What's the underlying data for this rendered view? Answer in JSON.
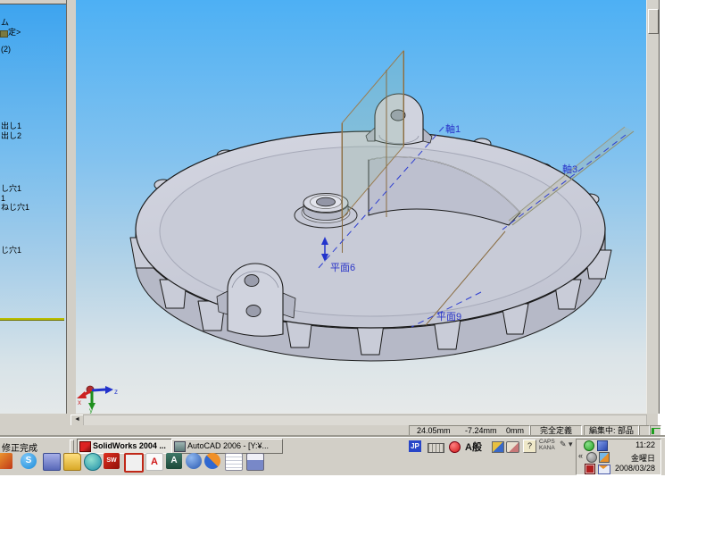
{
  "feature_tree": {
    "items": [
      {
        "label": "ム"
      },
      {
        "label": "定>"
      },
      {
        "label": "(2)"
      },
      {
        "label": "出し1"
      },
      {
        "label": "出し2"
      },
      {
        "label": "し穴1"
      },
      {
        "label": "1"
      },
      {
        "label": "ねじ穴1"
      },
      {
        "label": "じ穴1"
      }
    ]
  },
  "viewport": {
    "axis1_label": "軸1",
    "axis3_label": "軸3",
    "plane6_label": "平面6",
    "plane9_label": "平面9",
    "triad": {
      "x": "x",
      "y": "y",
      "z": "z"
    },
    "label_color": "#2a35c8",
    "bg_top_color": "#4db0f4",
    "bg_bottom_color": "#e6e9e9"
  },
  "scrollbars": {
    "left_arrow": "◄"
  },
  "status_bar": {
    "coord_x": "24.05mm",
    "coord_y": "-7.24mm",
    "coord_z": "0mm",
    "definition_status": "完全定義",
    "editing_status": "編集中: 部品"
  },
  "taskbar": {
    "left_text": "修正完成",
    "solidworks_button": "SolidWorks 2004 ...",
    "autocad_button": "AutoCAD 2006 - [Y:¥...",
    "ime": {
      "lang": "JP",
      "mode": "A般",
      "caps": "CAPS",
      "kana": "KANA",
      "help": "?",
      "pen": "✎ ▾"
    },
    "quick_launch_icons": [
      "app-icon",
      "skype-icon",
      "my-computer-icon",
      "folder-icon",
      "network-globe-icon",
      "solidworks-icon",
      "edrawings-icon",
      "acrobat-reader-icon",
      "autocad-icon",
      "browser-icon",
      "sync-icon",
      "notepad-icon",
      "pen-cup-icon"
    ],
    "glyphs": {
      "skype": "S",
      "solidworks": "SW",
      "acrobat": "A",
      "autocad": "A"
    },
    "tray": {
      "chevron": "«",
      "time": "11:22",
      "day": "金曜日",
      "date": "2008/03/28"
    }
  }
}
